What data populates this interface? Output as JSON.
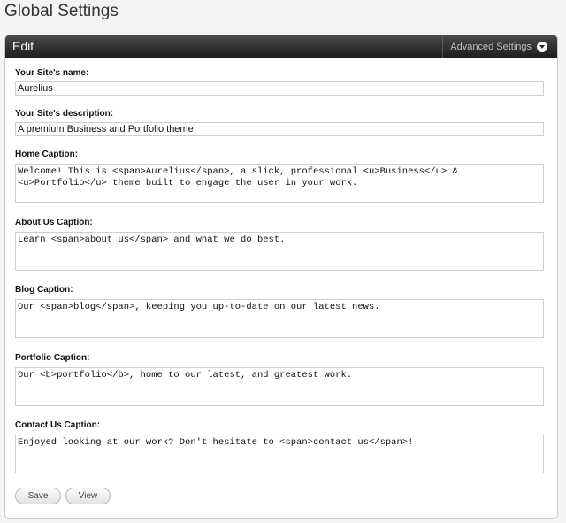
{
  "page_title": "Global Settings",
  "panel": {
    "title": "Edit",
    "advanced_settings_label": "Advanced Settings"
  },
  "fields": {
    "site_name": {
      "label": "Your Site's name:",
      "value": "Aurelius"
    },
    "site_description": {
      "label": "Your Site's description:",
      "value": "A premium Business and Portfolio theme"
    },
    "home_caption": {
      "label": "Home Caption:",
      "value": "Welcome! This is <span>Aurelius</span>, a slick, professional <u>Business</u> & <u>Portfolio</u> theme built to engage the user in your work."
    },
    "about_caption": {
      "label": "About Us Caption:",
      "value": "Learn <span>about us</span> and what we do best."
    },
    "blog_caption": {
      "label": "Blog Caption:",
      "value": "Our <span>blog</span>, keeping you up-to-date on our latest news."
    },
    "portfolio_caption": {
      "label": "Portfolio Caption:",
      "value": "Our <b>portfolio</b>, home to our latest, and greatest work."
    },
    "contact_caption": {
      "label": "Contact Us Caption:",
      "value": "Enjoyed looking at our work? Don't hesitate to <span>contact us</span>!"
    }
  },
  "buttons": {
    "save_label": "Save",
    "view_label": "View"
  },
  "icons": {
    "advanced_settings": "chevron-down-circle-icon"
  }
}
